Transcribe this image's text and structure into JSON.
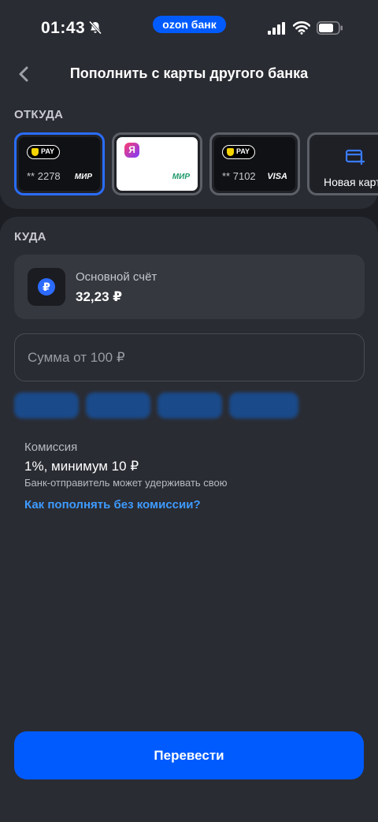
{
  "status_bar": {
    "time": "01:43",
    "brand": "ozon банк"
  },
  "header": {
    "title": "Пополнить с карты другого банка"
  },
  "from": {
    "label": "ОТКУДА",
    "cards": [
      {
        "pay_badge": "PAY",
        "number": "** 2278",
        "network": "МИР"
      },
      {
        "logo": "Я",
        "network": "МИР"
      },
      {
        "pay_badge": "PAY",
        "number": "** 7102",
        "network": "VISA"
      },
      {
        "label": "Новая карта"
      }
    ]
  },
  "to": {
    "label": "КУДА",
    "account": {
      "name": "Основной счёт",
      "balance": "32,23 ₽",
      "currency_symbol": "₽"
    }
  },
  "amount": {
    "placeholder": "Сумма от 100 ₽"
  },
  "commission": {
    "label": "Комиссия",
    "value": "1%, минимум 10 ₽",
    "note": "Банк-отправитель может удерживать свою",
    "link": "Как пополнять без комиссии?"
  },
  "submit_label": "Перевести",
  "colors": {
    "accent": "#005bff",
    "link": "#3e9bff",
    "background": "#1c1e24",
    "surface": "#2a2c33"
  }
}
